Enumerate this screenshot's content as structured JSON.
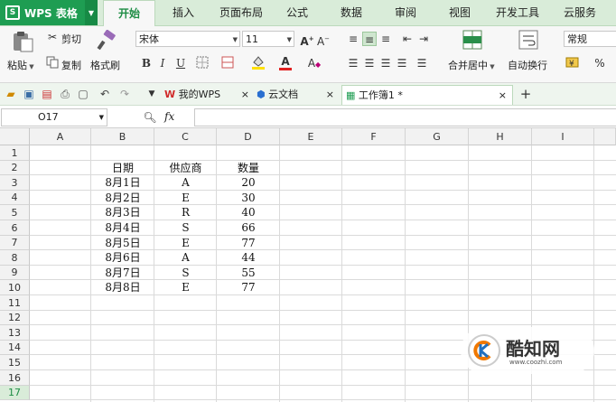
{
  "app": {
    "title": "WPS 表格"
  },
  "menu_tabs": [
    "开始",
    "插入",
    "页面布局",
    "公式",
    "数据",
    "审阅",
    "视图",
    "开发工具",
    "云服务"
  ],
  "ribbon": {
    "paste": "粘贴",
    "cut": "剪切",
    "copy": "复制",
    "format_painter": "格式刷",
    "font_name": "宋体",
    "font_size": "11",
    "bold": "B",
    "italic": "I",
    "underline": "U",
    "font_color_letter": "A",
    "merge_center": "合并居中",
    "wrap_text": "自动换行",
    "number_format": "常规",
    "percent": "%"
  },
  "doc_tabs": {
    "my_wps": "我的WPS",
    "cloud_docs": "云文档",
    "workbook": "工作簿1 *"
  },
  "formula_bar": {
    "name_box": "O17",
    "fx": "fx",
    "value": ""
  },
  "columns": [
    "A",
    "B",
    "C",
    "D",
    "E",
    "F",
    "G",
    "H",
    "I"
  ],
  "rows": [
    "1",
    "2",
    "3",
    "4",
    "5",
    "6",
    "7",
    "8",
    "9",
    "10",
    "11",
    "12",
    "13",
    "14",
    "15",
    "16",
    "17"
  ],
  "table": {
    "headers": [
      "日期",
      "供应商",
      "数量"
    ],
    "rows": [
      [
        "8月1日",
        "A",
        "20"
      ],
      [
        "8月2日",
        "E",
        "30"
      ],
      [
        "8月3日",
        "R",
        "40"
      ],
      [
        "8月4日",
        "S",
        "66"
      ],
      [
        "8月5日",
        "E",
        "77"
      ],
      [
        "8月6日",
        "A",
        "44"
      ],
      [
        "8月7日",
        "S",
        "55"
      ],
      [
        "8月8日",
        "E",
        "77"
      ]
    ]
  },
  "watermark": {
    "brand": "酷知网",
    "url": "www.coozhi.com"
  },
  "colors": {
    "accent": "#1e9d52",
    "tab_bar": "#d9ecd9"
  }
}
